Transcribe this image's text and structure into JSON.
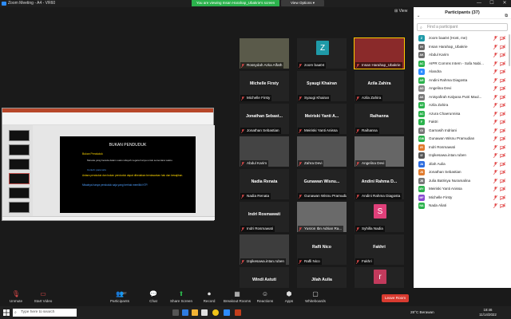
{
  "window": {
    "title": "Zoom Meeting - A4 - VR60",
    "minimize": "—",
    "maximize": "☐",
    "close": "✕"
  },
  "share_banner": "You are viewing Insan Harahap_Ubakrie's screen",
  "view_options": "View Options ▾",
  "view_button": "⊞ View",
  "slide": {
    "title": "BUKAN PENDUDUK",
    "bullet1": "Bukan Penduduk",
    "bullet2": "Mereka yang berada dalam suatu wilayah negara hanya untuk sementara waktu.",
    "bullet3": "Contoh: para turis",
    "bullet4": "Antara penduduk dan bukan penduduk dapat dibedakan berdasarkan hak dan kewajiban.",
    "bullet5": "Misalnya hanya penduduk saja yang berhak memiliki KTP."
  },
  "tiles": [
    {
      "label": "Rossydah Azka Alfath",
      "display": "",
      "kind": "video",
      "bg": "#5a5a4a"
    },
    {
      "label": "zoom baa04",
      "display": "",
      "kind": "avatar",
      "letter": "Z",
      "bg": "#1f9aa8"
    },
    {
      "label": "Insan Harahap_Ubakrie",
      "display": "",
      "kind": "video",
      "bg": "#8a2a2a",
      "active": true
    },
    {
      "label": "Michelle Firsty",
      "display": "Michelle Firsty",
      "kind": "name"
    },
    {
      "label": "Syaugi Khairan",
      "display": "Syaugi Khairan",
      "kind": "name"
    },
    {
      "label": "Azila Zahira",
      "display": "Azila Zahira",
      "kind": "name"
    },
    {
      "label": "Jonathan Sebastian",
      "display": "Jonathan Sebast...",
      "kind": "name"
    },
    {
      "label": "Meiriski Yanti Anissa",
      "display": "Meiriski Yanti A...",
      "kind": "name"
    },
    {
      "label": "Raihanna",
      "display": "Raihanna",
      "kind": "name"
    },
    {
      "label": "Abdul Karim",
      "display": "",
      "kind": "video",
      "bg": "#444"
    },
    {
      "label": "Zahra Devi",
      "display": "",
      "kind": "video",
      "bg": "#555"
    },
    {
      "label": "Angelina Devi",
      "display": "",
      "kind": "video",
      "bg": "#666"
    },
    {
      "label": "Nadia Renata",
      "display": "Nadia Renata",
      "kind": "name"
    },
    {
      "label": "Gunawan Wisnu Pramudian",
      "display": "Gunawan Wisnu...",
      "kind": "name"
    },
    {
      "label": "Andini Rahma Diagosta",
      "display": "Andini Rahma D...",
      "kind": "name"
    },
    {
      "label": "Indri Rosmawati",
      "display": "Indri Rosmawati",
      "kind": "name"
    },
    {
      "label": "Yusron Ibn Adrian Ra...",
      "display": "",
      "kind": "video",
      "bg": "#6a6a6a"
    },
    {
      "label": "Syhilla Nadia",
      "display": "",
      "kind": "avatar",
      "letter": "S",
      "bg": "#e0407a"
    },
    {
      "label": "Izqikesawa.intan.ruben",
      "display": "",
      "kind": "video",
      "bg": "#3d3d3d"
    },
    {
      "label": "Rafli Nico",
      "display": "Rafli Nico",
      "kind": "name"
    },
    {
      "label": "Fakhri",
      "display": "Fakhri",
      "kind": "name"
    },
    {
      "label": "Windi Astuti",
      "display": "Windi Astuti",
      "kind": "name"
    },
    {
      "label": "Jilah Aulia",
      "display": "Jilah Aulia",
      "kind": "name"
    },
    {
      "label": "",
      "display": "",
      "kind": "avatar",
      "letter": "r",
      "bg": "#c23a5c"
    }
  ],
  "participants_panel": {
    "title": "Participants (37)",
    "search_placeholder": "Find a participant",
    "mute_all": "Mute All",
    "more": "...",
    "list": [
      {
        "name": "zoom baa04 (Host, me)",
        "initials": "Z",
        "color": "#1f9aa8"
      },
      {
        "name": "Insan Harahap_Ubakrie",
        "initials": "IH",
        "color": "#666"
      },
      {
        "name": "Abdul Karim",
        "initials": "AK",
        "color": "#6b6b6b"
      },
      {
        "name": "AIPR Comms Intern - Safa Nabi...",
        "initials": "AC",
        "color": "#2bb24c"
      },
      {
        "name": "Alandra",
        "initials": "A",
        "color": "#2d8cff"
      },
      {
        "name": "Andini Rahma Diagosta",
        "initials": "AR",
        "color": "#2bb24c"
      },
      {
        "name": "Angelina Devi",
        "initials": "AD",
        "color": "#888"
      },
      {
        "name": "Anisyafirah Kalyana Putri Maul...",
        "initials": "AK",
        "color": "#777"
      },
      {
        "name": "Azila Zahira",
        "initials": "AZ",
        "color": "#2bb24c"
      },
      {
        "name": "Azura Chaerunnisa",
        "initials": "AC",
        "color": "#2bb24c"
      },
      {
        "name": "Faktri",
        "initials": "F",
        "color": "#2bb24c"
      },
      {
        "name": "Garnasih Indriani",
        "initials": "GI",
        "color": "#777"
      },
      {
        "name": "Gunawan Wisnu Pramudian",
        "initials": "GW",
        "color": "#2bb24c"
      },
      {
        "name": "Indri Rosmawati",
        "initials": "IR",
        "color": "#e07a2b"
      },
      {
        "name": "Izqikesawa.intan.ruben",
        "initials": "IZ",
        "color": "#555"
      },
      {
        "name": "Jilah Aulia",
        "initials": "JA",
        "color": "#2d6cdf"
      },
      {
        "name": "Jonathan Sebastian",
        "initials": "JS",
        "color": "#e07a2b"
      },
      {
        "name": "Julia Batrisya Nuramalina",
        "initials": "JB",
        "color": "#777"
      },
      {
        "name": "Meiriski Yanti Anissa",
        "initials": "MY",
        "color": "#2bb24c"
      },
      {
        "name": "Michelle Firsty",
        "initials": "MF",
        "color": "#8a4ad0"
      },
      {
        "name": "Nada Aliati",
        "initials": "NA",
        "color": "#2bb24c"
      }
    ]
  },
  "toolbar": {
    "unmute": "Unmute",
    "start_video": "Start Video",
    "participants": "Participants",
    "participants_count": "37",
    "chat": "Chat",
    "share_screen": "Share Screen",
    "record": "Record",
    "breakout": "Breakout Rooms",
    "reactions": "Reactions",
    "apps": "Apps",
    "whiteboards": "Whiteboards",
    "leave": "Leave Room"
  },
  "taskbar": {
    "search_placeholder": "Type here to search",
    "weather": "28°C  Berawan",
    "time": "18:46",
    "date": "11/14/2022"
  }
}
